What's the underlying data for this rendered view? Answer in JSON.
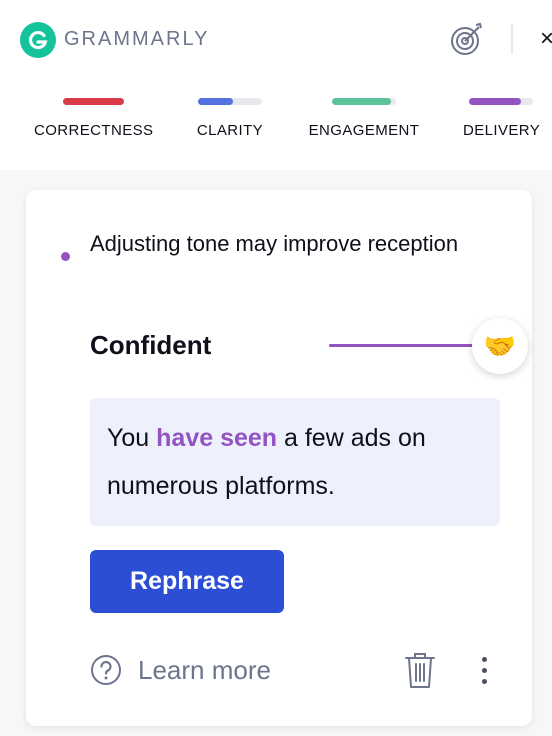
{
  "header": {
    "brand": "GRAMMARLY",
    "close_glyph": "×",
    "icons": {
      "logo": "grammarly-g-icon",
      "goals": "target-icon",
      "close": "close-icon"
    }
  },
  "scores": {
    "items": [
      {
        "label": "CORRECTNESS",
        "color": "#d93b47",
        "progress": 1.0
      },
      {
        "label": "CLARITY",
        "color": "#5570df",
        "progress": 0.55
      },
      {
        "label": "ENGAGEMENT",
        "color": "#5ec298",
        "progress": 0.92
      },
      {
        "label": "DELIVERY",
        "color": "#9253c3",
        "progress": 0.82
      }
    ]
  },
  "card": {
    "title": "Adjusting tone may improve reception",
    "tone": {
      "label": "Confident",
      "emoji": "🤝",
      "accent": "#9253c3"
    },
    "suggestion": {
      "before": "You ",
      "highlight": "have seen",
      "after": " a few ads on numerous platforms."
    },
    "rephrase_label": "Rephrase",
    "learn_more_label": "Learn more",
    "icons": {
      "help": "question-circle-icon",
      "trash": "trash-icon",
      "more": "more-vertical-icon"
    }
  },
  "colors": {
    "primary_button": "#2c4ed4",
    "suggestion_bg": "#eef1fb"
  }
}
